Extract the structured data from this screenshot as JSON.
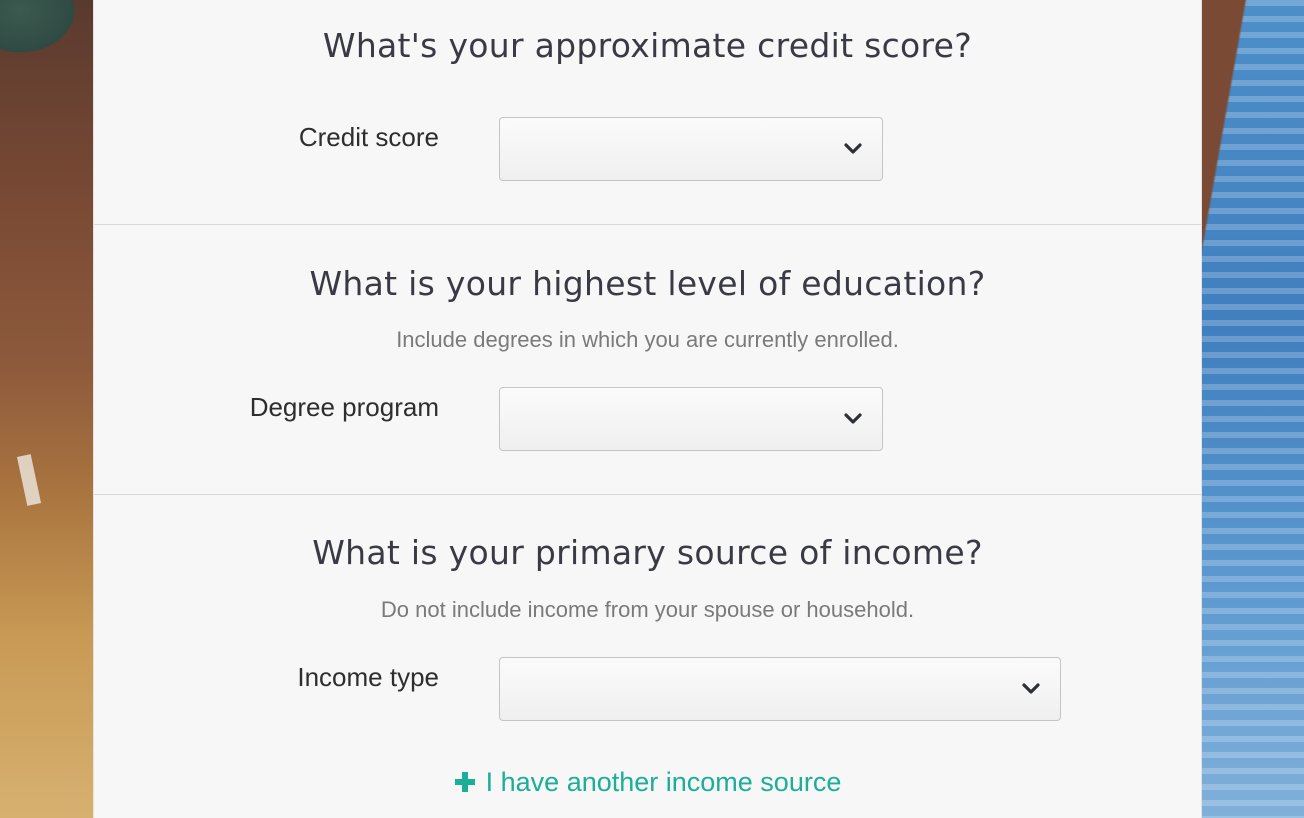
{
  "sections": [
    {
      "title": "What's your approximate credit score?",
      "subtitle": "",
      "field_label": "Credit score",
      "select_value": ""
    },
    {
      "title": "What is your highest level of education?",
      "subtitle": "Include degrees in which you are currently enrolled.",
      "field_label": "Degree program",
      "select_value": ""
    },
    {
      "title": "What is your primary source of income?",
      "subtitle": "Do not include income from your spouse or household.",
      "field_label": "Income type",
      "select_value": ""
    }
  ],
  "add_income_link": "I have another income source",
  "colors": {
    "accent": "#1bae98",
    "title_text": "#3a3a44",
    "subtitle_text": "#7a7a7a"
  },
  "icons": {
    "dropdown": "chevron-down-icon",
    "add": "plus-icon"
  }
}
